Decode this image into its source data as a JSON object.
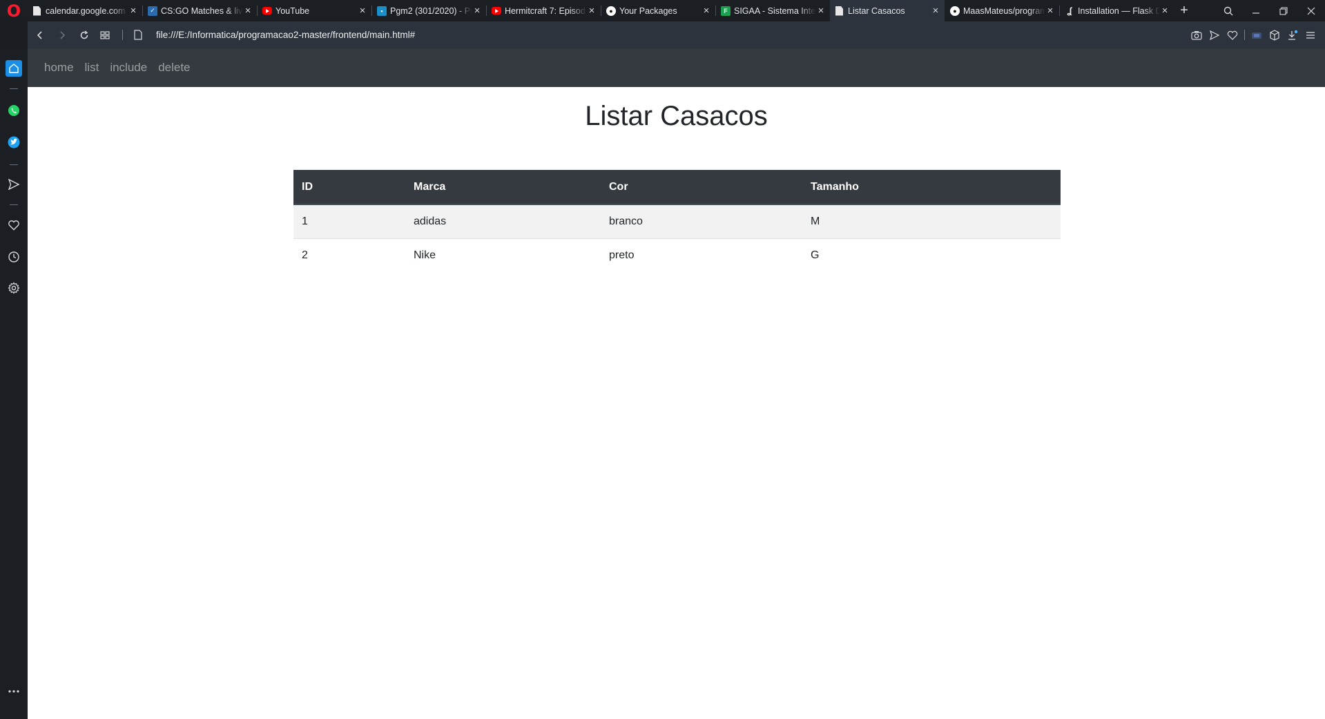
{
  "browser": {
    "tabs": [
      {
        "title": "calendar.google.com",
        "favicon": "document-icon"
      },
      {
        "title": "CS:GO Matches & live",
        "favicon": "csgo-icon"
      },
      {
        "title": "YouTube",
        "favicon": "youtube-icon"
      },
      {
        "title": "Pgm2 (301/2020) - Pr",
        "favicon": "classroom-icon"
      },
      {
        "title": "Hermitcraft 7: Episod",
        "favicon": "youtube-icon"
      },
      {
        "title": "Your Packages",
        "favicon": "github-icon"
      },
      {
        "title": "SIGAA - Sistema Inte",
        "favicon": "sigaa-icon"
      },
      {
        "title": "Listar Casacos",
        "favicon": "document-icon",
        "active": true
      },
      {
        "title": "MaasMateus/program",
        "favicon": "github-icon"
      },
      {
        "title": "Installation — Flask D",
        "favicon": "flask-icon"
      }
    ],
    "url": "file:///E:/Informatica/programacao2-master/frontend/main.html#"
  },
  "page": {
    "nav": [
      "home",
      "list",
      "include",
      "delete"
    ],
    "title": "Listar Casacos",
    "table": {
      "headers": [
        "ID",
        "Marca",
        "Cor",
        "Tamanho"
      ],
      "rows": [
        [
          "1",
          "adidas",
          "branco",
          "M"
        ],
        [
          "2",
          "Nike",
          "preto",
          "G"
        ]
      ]
    }
  },
  "colors": {
    "navbar_bg": "#343a40",
    "table_header_bg": "#343a40",
    "browser_chrome": "#2d333c",
    "opera_red": "#ff1b2d",
    "sidebar_accent": "#1b8ee6"
  }
}
